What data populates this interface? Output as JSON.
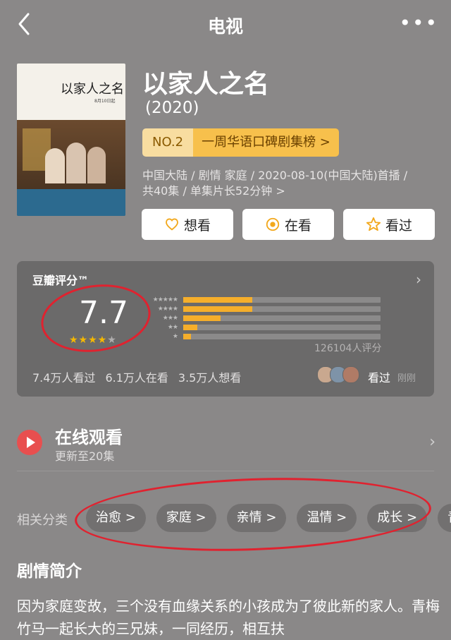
{
  "header": {
    "title": "电视",
    "back_icon": "back-chevron-icon",
    "more_icon": "more-dots-icon"
  },
  "show": {
    "name": "以家人之名",
    "year": "(2020)",
    "rank_no": "NO.2",
    "rank_label": "一周华语口碑剧集榜 >",
    "meta_line1": "中国大陆 / 剧情 家庭 / 2020-08-10(中国大陆)首播 /",
    "meta_line2": "共40集 / 单集片长52分钟 >"
  },
  "poster": {
    "title": "以家人之名",
    "note": "8月10日起"
  },
  "actions": [
    {
      "label": "想看",
      "icon": "heart-plus-icon"
    },
    {
      "label": "在看",
      "icon": "circle-dot-icon"
    },
    {
      "label": "看过",
      "icon": "star-icon"
    }
  ],
  "rating": {
    "label": "豆瓣评分™",
    "score": "7.7",
    "stars": 4,
    "distribution": [
      {
        "stars": "★★★★★",
        "fraction": 0.35
      },
      {
        "stars": "★★★★",
        "fraction": 0.35
      },
      {
        "stars": "★★★",
        "fraction": 0.19
      },
      {
        "stars": "★★",
        "fraction": 0.07
      },
      {
        "stars": "★",
        "fraction": 0.04
      }
    ],
    "raters": "126104人评分",
    "watched": "7.4万人看过",
    "watching": "6.1万人在看",
    "want": "3.5万人想看",
    "friends_label": "看过",
    "friends_time": "刚刚"
  },
  "online": {
    "title": "在线观看",
    "subtitle": "更新至20集"
  },
  "categories": {
    "label": "相关分类",
    "items": [
      "治愈 >",
      "家庭 >",
      "亲情 >",
      "温情 >",
      "成长 >",
      "青"
    ]
  },
  "synopsis": {
    "heading": "剧情简介",
    "text": "因为家庭变故，三个没有血缘关系的小孩成为了彼此新的家人。青梅竹马一起长大的三兄妹，一同经历，相互扶"
  },
  "colors": {
    "background": "#8a8888",
    "accent": "#f5ae2b",
    "annotation": "#e0222f"
  }
}
